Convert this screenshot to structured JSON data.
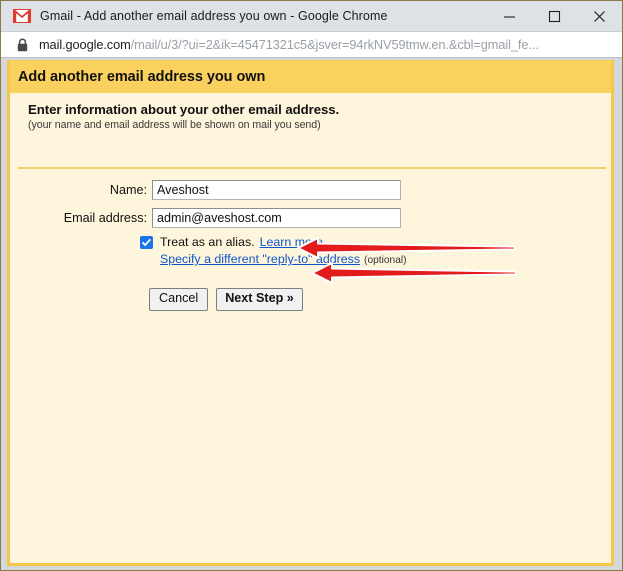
{
  "window": {
    "title": "Gmail - Add another email address you own - Google Chrome",
    "favicon": "gmail-icon",
    "controls": {
      "minimize": "minimize-icon",
      "maximize": "maximize-icon",
      "close": "close-icon"
    }
  },
  "address_bar": {
    "security_icon": "lock-icon",
    "url_host": "mail.google.com",
    "url_path": "/mail/u/3/?ui=2&ik=45471321c5&jsver=94rkNV59tmw.en.&cbl=gmail_fe..."
  },
  "dialog": {
    "header_title": "Add another email address you own",
    "intro_heading": "Enter information about your other email address.",
    "intro_sub": "(your name and email address will be shown on mail you send)",
    "fields": [
      {
        "label": "Name:",
        "value": "Aveshost",
        "name": "name-input"
      },
      {
        "label": "Email address:",
        "value": "admin@aveshost.com",
        "name": "email-address-input"
      }
    ],
    "alias": {
      "checked": true,
      "label": "Treat as an alias.",
      "learn_more": "Learn more"
    },
    "reply_to": {
      "link": "Specify a different \"reply-to\" address",
      "optional": "(optional)"
    },
    "buttons": {
      "cancel": "Cancel",
      "next_step": "Next Step »"
    }
  },
  "annotations": {
    "arrow_color": "#e21b1b",
    "arrow_outline": "#ffffff",
    "arrows": [
      {
        "name": "arrow-pointing-to-name-field",
        "target": "name-input"
      },
      {
        "name": "arrow-pointing-to-email-field",
        "target": "email-address-input"
      }
    ]
  },
  "colors": {
    "header_gold": "#fad15e",
    "body_cream": "#fdf6dc",
    "border_gold": "#f5c84c",
    "link_blue": "#1155cc",
    "checkbox_blue": "#1a73e8"
  }
}
